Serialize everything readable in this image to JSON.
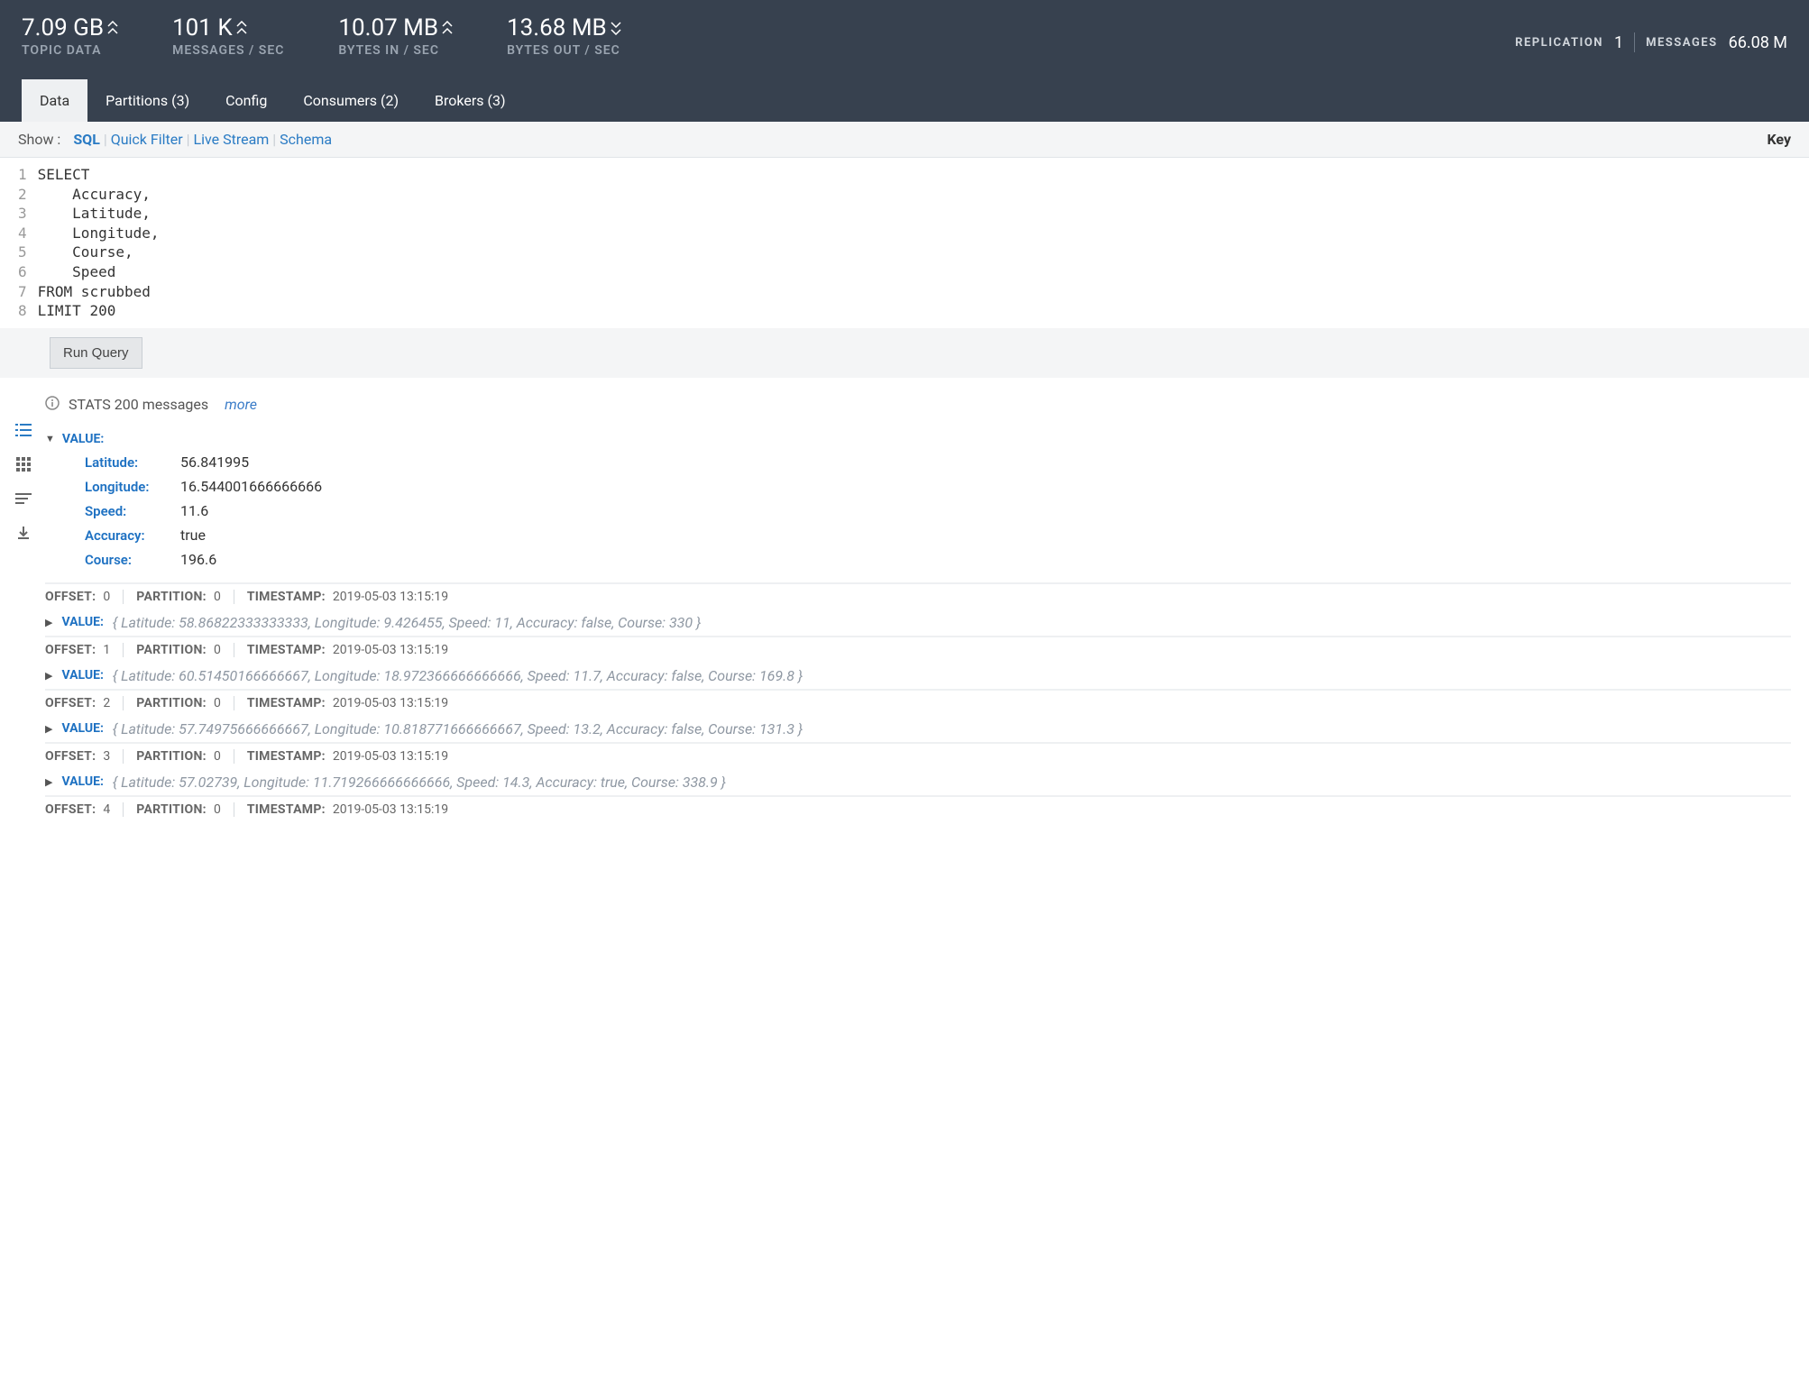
{
  "metrics": {
    "topic_data": {
      "value": "7.09 GB",
      "label": "TOPIC DATA",
      "dir": "up"
    },
    "messages_sec": {
      "value": "101 K",
      "label": "MESSAGES / SEC",
      "dir": "up"
    },
    "bytes_in": {
      "value": "10.07 MB",
      "label": "BYTES IN / SEC",
      "dir": "up"
    },
    "bytes_out": {
      "value": "13.68 MB",
      "label": "BYTES OUT / SEC",
      "dir": "down"
    }
  },
  "right_info": {
    "replication_label": "REPLICATION",
    "replication_value": "1",
    "messages_label": "MESSAGES",
    "messages_value": "66.08 M"
  },
  "tabs": [
    {
      "label": "Data",
      "active": true
    },
    {
      "label": "Partitions (3)"
    },
    {
      "label": "Config"
    },
    {
      "label": "Consumers (2)"
    },
    {
      "label": "Brokers (3)"
    }
  ],
  "subbar": {
    "show": "Show :",
    "links": [
      "SQL",
      "Quick Filter",
      "Live Stream",
      "Schema"
    ],
    "active": "SQL",
    "key": "Key"
  },
  "sql": {
    "lines": [
      {
        "n": "1",
        "html": "<span class='kw'>SELECT</span>"
      },
      {
        "n": "2",
        "html": "    Accuracy,"
      },
      {
        "n": "3",
        "html": "    Latitude,"
      },
      {
        "n": "4",
        "html": "    Longitude,"
      },
      {
        "n": "5",
        "html": "    Course,"
      },
      {
        "n": "6",
        "html": "    Speed"
      },
      {
        "n": "7",
        "html": "<span class='kw'>FROM</span> scrubbed"
      },
      {
        "n": "8",
        "html": "<span class='kw'>LIMIT</span> <span class='num'>200</span>"
      }
    ]
  },
  "run_button": "Run Query",
  "stats": {
    "text": "STATS 200 messages",
    "more": "more"
  },
  "value_label": "VALUE:",
  "expanded": {
    "fields": [
      {
        "k": "Latitude:",
        "v": "56.841995"
      },
      {
        "k": "Longitude:",
        "v": "16.544001666666666"
      },
      {
        "k": "Speed:",
        "v": "11.6"
      },
      {
        "k": "Accuracy:",
        "v": "true"
      },
      {
        "k": "Course:",
        "v": "196.6"
      }
    ]
  },
  "meta_labels": {
    "offset": "OFFSET:",
    "partition": "PARTITION:",
    "timestamp": "TIMESTAMP:"
  },
  "rows": [
    {
      "offset": "0",
      "partition": "0",
      "timestamp": "2019-05-03 13:15:19",
      "preview": "{ Latitude: 58.86822333333333, Longitude: 9.426455, Speed: 11, Accuracy: false, Course: 330 }"
    },
    {
      "offset": "1",
      "partition": "0",
      "timestamp": "2019-05-03 13:15:19",
      "preview": "{ Latitude: 60.51450166666667, Longitude: 18.972366666666666, Speed: 11.7, Accuracy: false, Course: 169.8 }"
    },
    {
      "offset": "2",
      "partition": "0",
      "timestamp": "2019-05-03 13:15:19",
      "preview": "{ Latitude: 57.74975666666667, Longitude: 10.818771666666667, Speed: 13.2, Accuracy: false, Course: 131.3 }"
    },
    {
      "offset": "3",
      "partition": "0",
      "timestamp": "2019-05-03 13:15:19",
      "preview": "{ Latitude: 57.02739, Longitude: 11.719266666666666, Speed: 14.3, Accuracy: true, Course: 338.9 }"
    },
    {
      "offset": "4",
      "partition": "0",
      "timestamp": "2019-05-03 13:15:19",
      "preview": ""
    }
  ]
}
